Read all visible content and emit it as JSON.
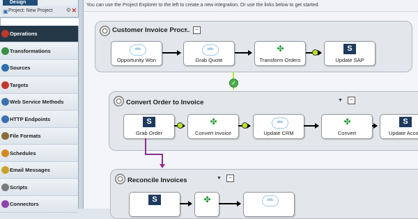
{
  "sidebar": {
    "design_tab": "Design",
    "project_label": "Project: New Project",
    "search_value": "",
    "items": [
      {
        "label": "Operations",
        "icon": "operations-icon",
        "color": "#c0392b"
      },
      {
        "label": "Transformations",
        "icon": "transformations-icon",
        "color": "#3a8f4a"
      },
      {
        "label": "Sources",
        "icon": "sources-icon",
        "color": "#2e6db0"
      },
      {
        "label": "Targets",
        "icon": "targets-icon",
        "color": "#c0392b"
      },
      {
        "label": "Web Service Methods",
        "icon": "web-service-icon",
        "color": "#3a6fb0"
      },
      {
        "label": "HTTP Endpoints",
        "icon": "http-endpoints-icon",
        "color": "#3a6fb0"
      },
      {
        "label": "File Formats",
        "icon": "file-formats-icon",
        "color": "#8a6d3b"
      },
      {
        "label": "Schedules",
        "icon": "schedules-icon",
        "color": "#d48a1f"
      },
      {
        "label": "Email Messages",
        "icon": "email-messages-icon",
        "color": "#c9a227"
      },
      {
        "label": "Scripts",
        "icon": "scripts-icon",
        "color": "#7a7a7a"
      },
      {
        "label": "Connectors",
        "icon": "connectors-icon",
        "color": "#8e44ad"
      }
    ],
    "active_index": 0
  },
  "info_bar": "You can use the Project Explorer to the left to create a new integration. Or use the links below to get started.",
  "groups": [
    {
      "title": "Customer Invoice Proc...",
      "nodes": [
        {
          "label": "Opportunity Won",
          "icon": "salesforce-icon"
        },
        {
          "label": "Grab Quote",
          "icon": "salesforce-icon"
        },
        {
          "label": "Transform Orders",
          "icon": "transform-icon"
        },
        {
          "label": "Update SAP",
          "icon": "sap-icon"
        }
      ]
    },
    {
      "title": "Convert Order to Invoice",
      "nodes": [
        {
          "label": "Grab Order",
          "icon": "sap-icon"
        },
        {
          "label": "Convert Invoice",
          "icon": "transform-icon"
        },
        {
          "label": "Update CRM",
          "icon": "salesforce-icon"
        },
        {
          "label": "Convert",
          "icon": "transform-icon"
        },
        {
          "label": "Update Acco",
          "icon": "sap-icon"
        }
      ]
    },
    {
      "title": "Reconcile Invoices",
      "nodes": [
        {
          "label": "",
          "icon": "sap-icon"
        },
        {
          "label": "",
          "icon": "transform-icon"
        },
        {
          "label": "",
          "icon": "salesforce-icon"
        }
      ]
    }
  ],
  "icon_texts": {
    "sap": "S",
    "salesforce": "sfdc"
  },
  "colors": {
    "nav_active": "#243848",
    "success_link": "#b8e61f",
    "failure_link": "#8e2c8c"
  }
}
